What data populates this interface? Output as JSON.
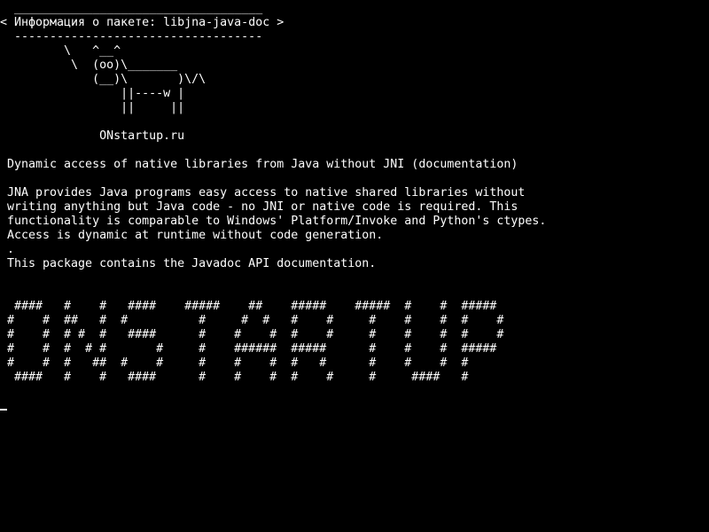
{
  "colors": {
    "background": "#000000",
    "foreground": "#ffffff"
  },
  "terminal": {
    "balloon": {
      "top_border": " ___________________________________",
      "text": "< Информация о пакете: libjna-java-doc >",
      "bottom_border": " -----------------------------------"
    },
    "cow": [
      "        \\   ^__^",
      "         \\  (oo)\\_______",
      "            (__)\\       )\\/\\",
      "                ||----w |",
      "                ||     ||"
    ],
    "site": "             ONstartup.ru",
    "summary": "Dynamic access of native libraries from Java without JNI (documentation)",
    "description": [
      "JNA provides Java programs easy access to native shared libraries without",
      "writing anything but Java code - no JNI or native code is required. This",
      "functionality is comparable to Windows' Platform/Invoke and Python's ctypes.",
      "Access is dynamic at runtime without code generation.",
      ".",
      "This package contains the Javadoc API documentation."
    ],
    "banner": [
      " ####   #    #   ####    #####    ##    #####    #####  #    #  #####",
      "#    #  ##   #  #          #     #  #   #    #     #    #    #  #    #",
      "#    #  # #  #   ####      #    #    #  #    #     #    #    #  #    #",
      "#    #  #  # #       #     #    ######  #####      #    #    #  #####",
      "#    #  #   ##  #    #     #    #    #  #   #      #    #    #  #",
      " ####   #    #   ####      #    #    #  #    #     #     ####   #"
    ]
  }
}
